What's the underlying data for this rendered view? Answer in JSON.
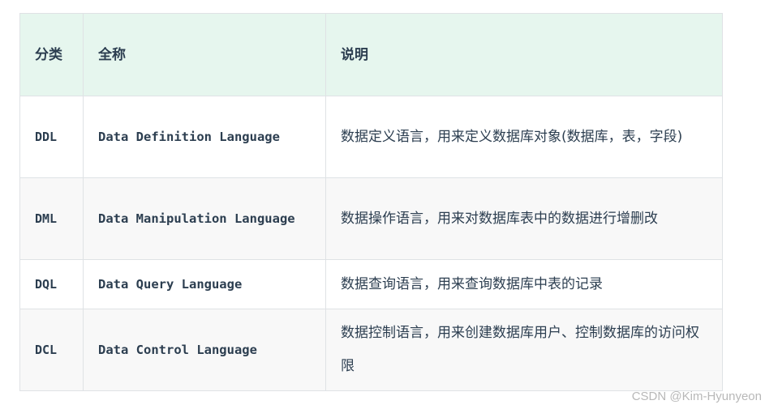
{
  "table": {
    "headers": {
      "category": "分类",
      "full_name": "全称",
      "description": "说明"
    },
    "rows": [
      {
        "category": "DDL",
        "full_name": "Data Definition Language",
        "description": "数据定义语言，用来定义数据库对象(数据库，表，字段)"
      },
      {
        "category": "DML",
        "full_name": "Data Manipulation Language",
        "description": "数据操作语言，用来对数据库表中的数据进行增删改"
      },
      {
        "category": "DQL",
        "full_name": "Data Query Language",
        "description": "数据查询语言，用来查询数据库中表的记录"
      },
      {
        "category": "DCL",
        "full_name": "Data Control Language",
        "description": "数据控制语言，用来创建数据库用户、控制数据库的访问权限"
      }
    ]
  },
  "watermark": "CSDN @Kim-Hyunyeon"
}
